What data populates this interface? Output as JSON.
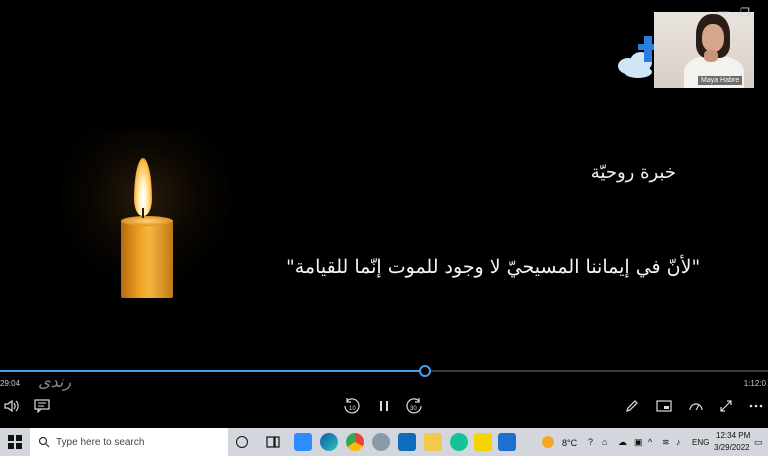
{
  "video": {
    "title_arabic": "خبرة روحيّة",
    "quote_arabic": "\"لأنّ في إيماننا المسيحيّ لا وجود للموت إنّما للقيامة\"",
    "watermark": "رندى"
  },
  "participants": {
    "name": "Maya Habre"
  },
  "player": {
    "elapsed": "29:04",
    "duration": "1:12:0",
    "progress_fraction": 0.55,
    "skip_back_label": "10",
    "skip_forward_label": "30",
    "accent_color": "#4a9fe8"
  },
  "taskbar": {
    "search_placeholder": "Type here to search",
    "weather": "8°C",
    "language": "ENG",
    "time": "12:34 PM",
    "date": "3/29/2022"
  }
}
